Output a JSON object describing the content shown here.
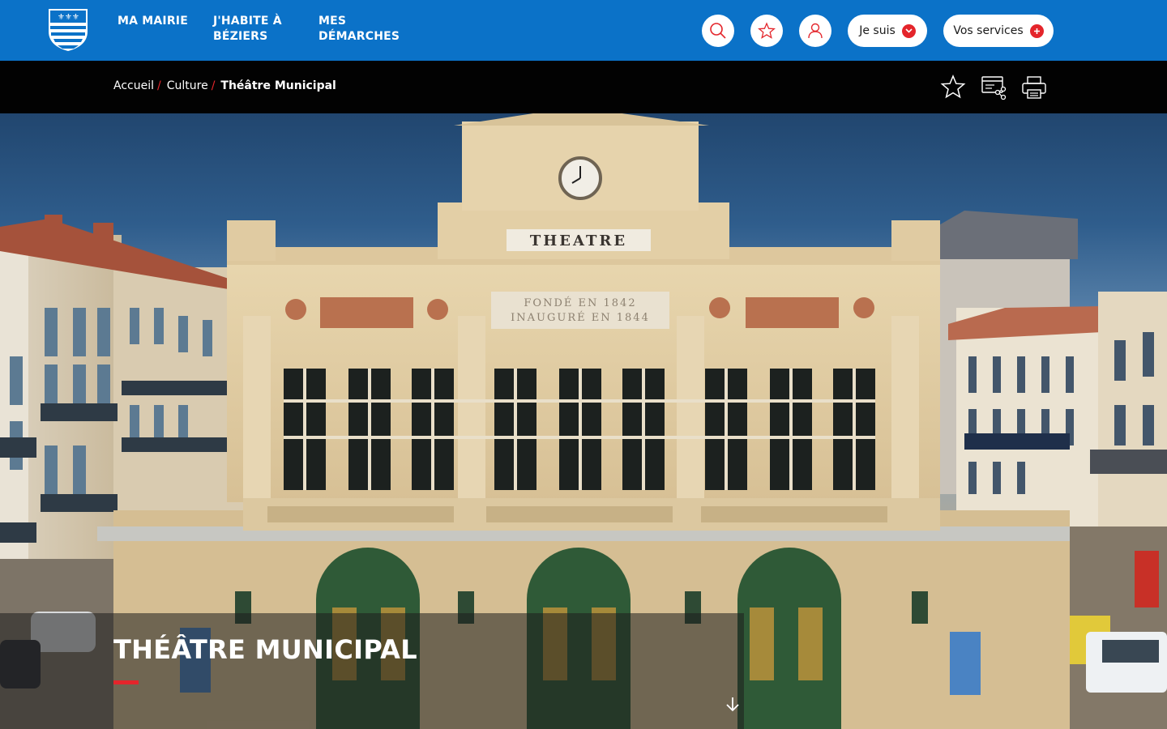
{
  "header": {
    "logo_name": "Béziers coat of arms",
    "nav": [
      {
        "label": "MA MAIRIE"
      },
      {
        "label": "J'HABITE À BÉZIERS"
      },
      {
        "label": "MES DÉMARCHES"
      }
    ],
    "je_suis_label": "Je suis",
    "services_label": "Vos services",
    "icons": [
      "search-icon",
      "favorites-icon",
      "account-icon"
    ],
    "colors": {
      "primary": "#0b72c8",
      "accent": "#e4252b"
    }
  },
  "breadcrumb": {
    "items": [
      "Accueil",
      "Culture"
    ],
    "current": "Théâtre Municipal",
    "separator": "/"
  },
  "tools": [
    "favorite-icon",
    "share-icon",
    "print-icon"
  ],
  "hero": {
    "title": "THÉÂTRE MUNICIPAL",
    "facade_text": "THEATRE",
    "inscription_line1": "FONDÉ EN 1842",
    "inscription_line2": "INAUGURÉ EN 1844"
  }
}
